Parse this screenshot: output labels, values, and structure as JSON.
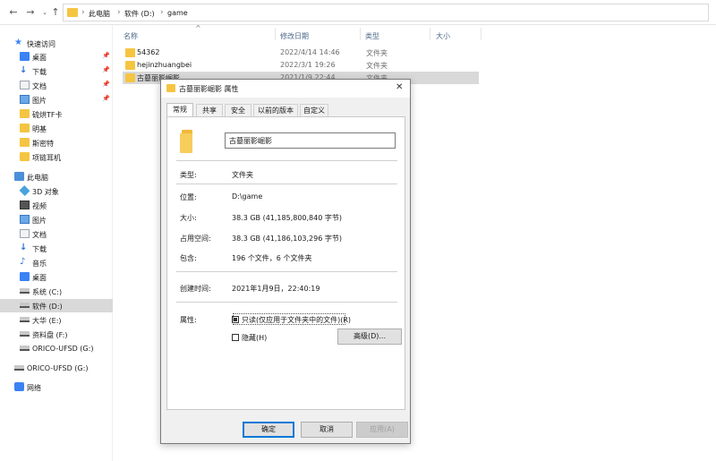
{
  "address": {
    "crumbs": [
      "此电脑",
      "软件 (D:)",
      "game"
    ]
  },
  "sidebar": {
    "items": [
      {
        "label": "快速访问",
        "icon": "star-icon"
      },
      {
        "label": "桌面",
        "icon": "desktop-icon",
        "pinned": true
      },
      {
        "label": "下载",
        "icon": "download-icon",
        "pinned": true
      },
      {
        "label": "文档",
        "icon": "document-icon",
        "pinned": true
      },
      {
        "label": "图片",
        "icon": "picture-icon",
        "pinned": true
      },
      {
        "label": "硫烘TF卡",
        "icon": "folder-icon"
      },
      {
        "label": "明基",
        "icon": "folder-icon"
      },
      {
        "label": "斯密特",
        "icon": "folder-icon"
      },
      {
        "label": "项链耳机",
        "icon": "folder-icon"
      },
      {
        "label": "此电脑",
        "icon": "computer-icon"
      },
      {
        "label": "3D 对象",
        "icon": "3d-objects-icon"
      },
      {
        "label": "视频",
        "icon": "video-icon"
      },
      {
        "label": "图片",
        "icon": "picture-icon"
      },
      {
        "label": "文档",
        "icon": "document-icon"
      },
      {
        "label": "下载",
        "icon": "download-icon"
      },
      {
        "label": "音乐",
        "icon": "music-icon"
      },
      {
        "label": "桌面",
        "icon": "desktop-icon"
      },
      {
        "label": "系统 (C:)",
        "icon": "drive-icon"
      },
      {
        "label": "软件 (D:)",
        "icon": "drive-icon",
        "selected": true
      },
      {
        "label": "大华 (E:)",
        "icon": "drive-icon"
      },
      {
        "label": "资料盘 (F:)",
        "icon": "drive-icon"
      },
      {
        "label": "ORICO-UFSD (G:)",
        "icon": "drive-icon"
      },
      {
        "label": "ORICO-UFSD (G:)",
        "icon": "drive-icon"
      },
      {
        "label": "网络",
        "icon": "network-icon"
      }
    ]
  },
  "filelist": {
    "columns": [
      "名称",
      "修改日期",
      "类型",
      "大小"
    ],
    "rows": [
      {
        "name": "54362",
        "date": "2022/4/14 14:46",
        "type": "文件夹"
      },
      {
        "name": "hejinzhuangbei",
        "date": "2022/3/1 19:26",
        "type": "文件夹"
      },
      {
        "name": "古墓丽影崛影",
        "date": "2021/1/9 22:44",
        "type": "文件夹",
        "selected": true
      }
    ]
  },
  "dialog": {
    "title": "古墓丽影崛影 属性",
    "close": "✕",
    "tabs": [
      "常规",
      "共享",
      "安全",
      "以前的版本",
      "自定义"
    ],
    "folder_name": "古墓丽影崛影",
    "props": {
      "type_label": "类型:",
      "type_value": "文件夹",
      "location_label": "位置:",
      "location_value": "D:\\game",
      "size_label": "大小:",
      "size_value": "38.3 GB (41,185,800,840 字节)",
      "disk_label": "占用空间:",
      "disk_value": "38.3 GB (41,186,103,296 字节)",
      "contains_label": "包含:",
      "contains_value": "196 个文件，6 个文件夹",
      "created_label": "创建时间:",
      "created_value": "2021年1月9日，22:40:19",
      "attr_label": "属性:",
      "readonly_label": "只读(仅应用于文件夹中的文件)(R)",
      "hidden_label": "隐藏(H)",
      "advanced_label": "高级(D)..."
    },
    "buttons": {
      "ok": "确定",
      "cancel": "取消",
      "apply": "应用(A)"
    }
  },
  "colors": {
    "folder": "#f5c542",
    "accent": "#0078d7",
    "selected": "#d9d9d9"
  }
}
